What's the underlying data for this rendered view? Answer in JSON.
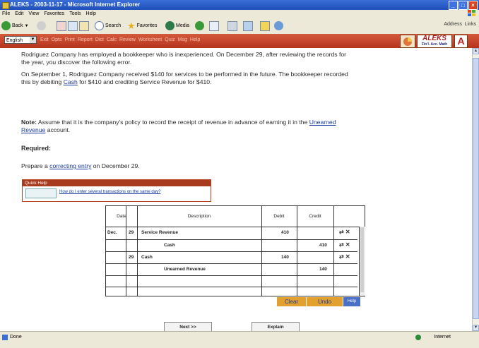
{
  "window": {
    "title": "ALEKS - 2003-11-17 - Microsoft Internet Explorer",
    "min": "_",
    "max": "□",
    "close": "×"
  },
  "menu": [
    "File",
    "Edit",
    "View",
    "Favorites",
    "Tools",
    "Help"
  ],
  "toolbar": {
    "back": "Back",
    "search": "Search",
    "favorites": "Favorites",
    "media": "Media",
    "address": "Address",
    "links": "Links"
  },
  "aleks": {
    "language": "English",
    "nav": [
      "Exit",
      "Opts",
      "Print",
      "Report",
      "Dict",
      "Calc",
      "Review",
      "Worksheet",
      "Quiz",
      "Msg",
      "Help"
    ],
    "logo_main": "ALEKS",
    "logo_sub": "Fin'l. Acc. Math",
    "a_letter": "A",
    "brand_color": "#b6331d"
  },
  "problem": {
    "p1": "Rodriguez Company has employed a bookkeeper who is inexperienced. On December 29, after reviewing the records for the year, you discover the following error.",
    "p2_pre": "On September 1, Rodriguez Company received $140 for services to be performed in the future. The bookkeeper recorded this by debiting ",
    "p2_link": "Cash",
    "p2_post": " for $410 and crediting Service Revenue for $410.",
    "note_label": "Note:",
    "note_pre": " Assume that it is the company's policy to record the receipt of revenue in advance of earning it in the ",
    "note_link": "Unearned Revenue",
    "note_post": " account.",
    "required": "Required:",
    "prep_pre": "Prepare a ",
    "prep_link": "correcting entry",
    "prep_post": " on December 29."
  },
  "quick_help": {
    "title": "Quick Help",
    "link": "How do I enter several transactions on the same day?"
  },
  "journal": {
    "headers": {
      "date": "Date",
      "description": "Description",
      "debit": "Debit",
      "credit": "Credit"
    },
    "rows": [
      {
        "month": "Dec.",
        "day": "29",
        "desc": "Service Revenue",
        "indent": false,
        "debit": "410",
        "credit": ""
      },
      {
        "month": "",
        "day": "",
        "desc": "Cash",
        "indent": true,
        "debit": "",
        "credit": "410"
      },
      {
        "month": "",
        "day": "29",
        "desc": "Cash",
        "indent": false,
        "debit": "140",
        "credit": ""
      },
      {
        "month": "",
        "day": "",
        "desc": "Unearned Revenue",
        "indent": true,
        "debit": "",
        "credit": "140"
      }
    ],
    "row_icons": "⇄ ✕"
  },
  "buttons": {
    "clear": "Clear",
    "undo": "Undo",
    "help": "Help",
    "next": "Next >>",
    "explain": "Explain"
  },
  "status": {
    "text": "Done",
    "zone": "Internet"
  }
}
